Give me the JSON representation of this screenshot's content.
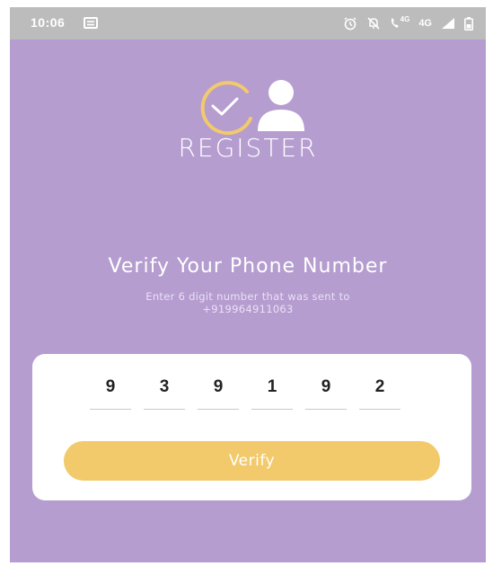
{
  "status_bar": {
    "time": "10:06",
    "network_label": "4G",
    "network_label_small": "4G"
  },
  "header": {
    "title": "REGISTER"
  },
  "verify": {
    "title": "Verify Your Phone Number",
    "subtitle_line1": "Enter 6 digit number that was sent to",
    "phone_number": "+919964911063"
  },
  "otp": {
    "digits": [
      "9",
      "3",
      "9",
      "1",
      "9",
      "2"
    ]
  },
  "actions": {
    "verify_label": "Verify"
  },
  "colors": {
    "background": "#b59dd0",
    "status_bar": "#bcbcbc",
    "accent": "#f2ca6b",
    "card": "#ffffff"
  },
  "icons": [
    "message-icon",
    "alarm-icon",
    "mute-icon",
    "call-icon",
    "signal-icon",
    "battery-icon",
    "check-circle-icon",
    "user-icon"
  ]
}
